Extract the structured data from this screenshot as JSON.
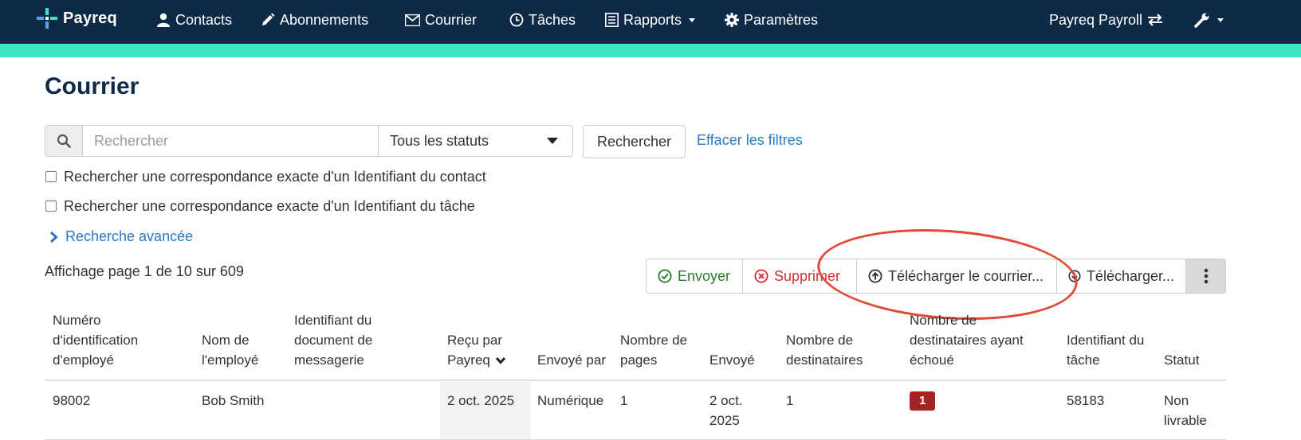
{
  "nav": {
    "brand": "Payreq",
    "items": [
      "Contacts",
      "Abonnements",
      "Courrier",
      "Tâches",
      "Rapports",
      "Paramètres"
    ],
    "account": "Payreq Payroll"
  },
  "page": {
    "title": "Courrier"
  },
  "search": {
    "placeholder": "Rechercher",
    "value": "",
    "status_selected": "Tous les statuts",
    "search_button": "Rechercher",
    "clear_filters": "Effacer les filtres",
    "exact_contact_label": "Rechercher une correspondance exacte d'un Identifiant du contact",
    "exact_task_label": "Rechercher une correspondance exacte d'un Identifiant du tâche",
    "advanced_search": "Recherche avancée"
  },
  "pagination": {
    "text": "Affichage page 1 de 10 sur 609"
  },
  "actions": {
    "send": "Envoyer",
    "delete": "Supprimer",
    "upload": "Télécharger le courrier...",
    "download": "Télécharger..."
  },
  "table": {
    "headers": {
      "employee_id": [
        "Numéro",
        "d'identification",
        "d'employé"
      ],
      "employee_name": [
        "Nom de",
        "l'employé"
      ],
      "doc_id": [
        "Identifiant du",
        "document de",
        "messagerie"
      ],
      "received": [
        "Reçu par",
        "Payreq"
      ],
      "sent_by": [
        "Envoyé par"
      ],
      "pages": [
        "Nombre de",
        "pages"
      ],
      "sent": [
        "Envoyé"
      ],
      "recipients": [
        "Nombre de",
        "destinataires"
      ],
      "failed": [
        "Nombre de",
        "destinataires ayant",
        "échoué"
      ],
      "task_id": [
        "Identifiant du",
        "tâche"
      ],
      "status": [
        "Statut"
      ]
    },
    "rows": [
      {
        "employee_id": "98002",
        "employee_name": "Bob Smith",
        "doc_id": "",
        "received": "2 oct. 2025",
        "sent_by": "Numérique",
        "pages": "1",
        "sent": [
          "2 oct.",
          "2025"
        ],
        "recipients": "1",
        "failed": "1",
        "task_id": "58183",
        "status": [
          "Non",
          "livrable"
        ]
      }
    ]
  },
  "colors": {
    "nav_bg": "#0e2a47",
    "accent": "#3ee6c1",
    "link": "#2a78c4",
    "send": "#2b7a2b",
    "delete": "#d03030",
    "badge": "#a52323",
    "annotation": "#e14a35"
  },
  "icons": [
    "payreq-logo-icon",
    "person-icon",
    "pencil-icon",
    "envelope-icon",
    "clock-icon",
    "report-icon",
    "gear-icon",
    "swap-icon",
    "wrench-icon",
    "search-icon",
    "chevron-right-icon",
    "check-circle-icon",
    "x-circle-icon",
    "upload-circle-icon",
    "download-circle-icon",
    "kebab-icon",
    "sort-chevron-down-icon"
  ]
}
